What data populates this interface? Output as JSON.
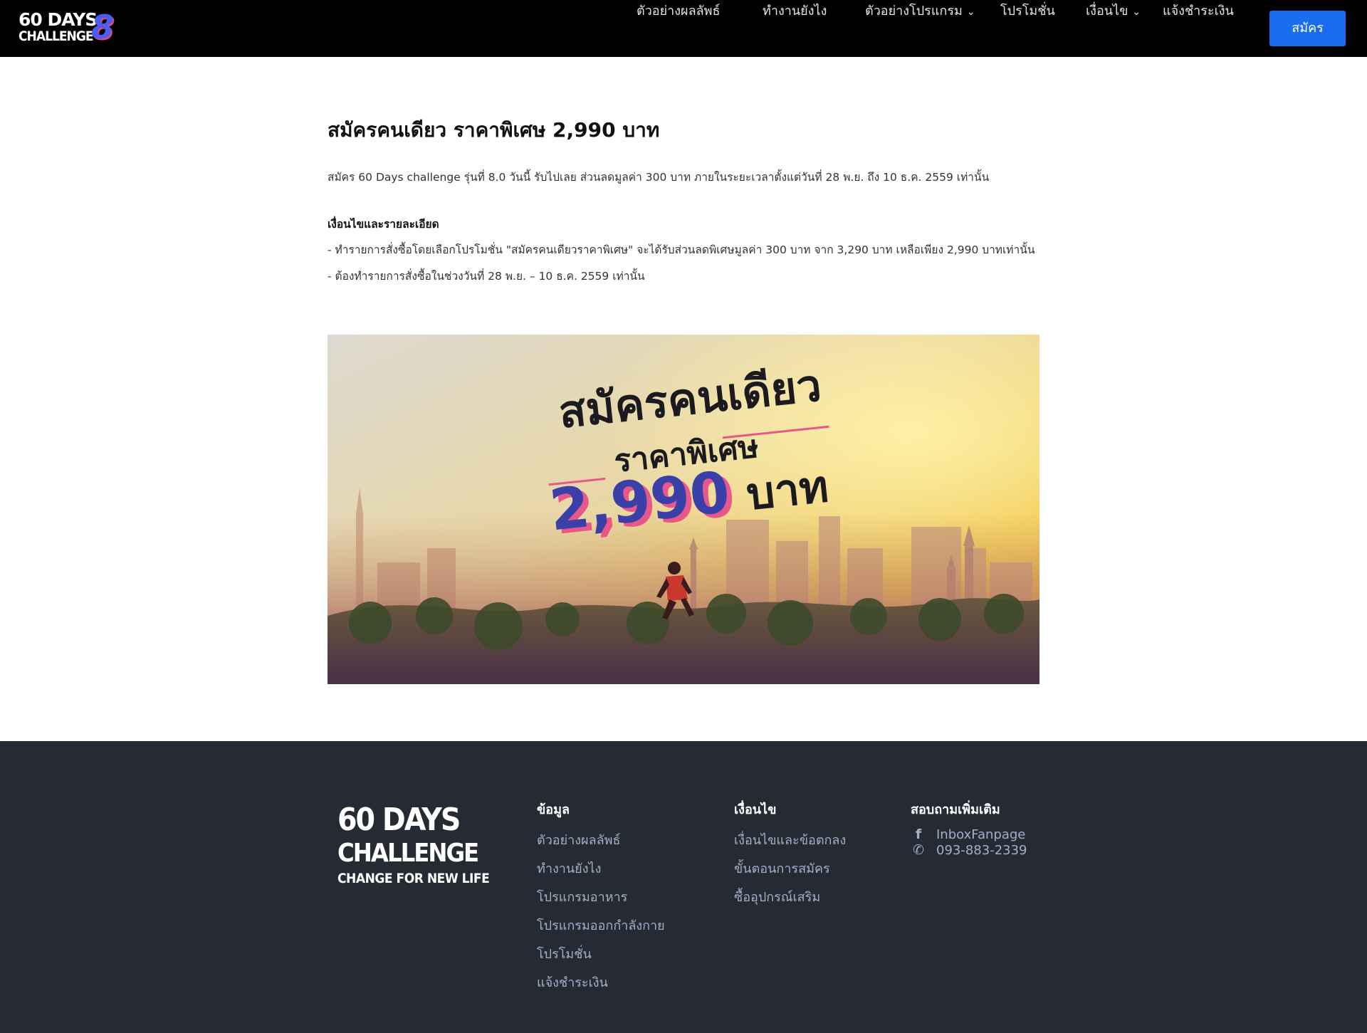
{
  "header": {
    "logo": {
      "line1": "60 DAYS",
      "line2": "CHALLENGE",
      "badge": "8"
    },
    "nav": [
      {
        "label": "ตัวอย่างผลลัพธ์",
        "dropdown": false
      },
      {
        "label": "ทำงานยังไง",
        "dropdown": false
      },
      {
        "label": "ตัวอย่างโปรแกรม",
        "dropdown": true
      },
      {
        "label": "โปรโมชั่น",
        "dropdown": false
      },
      {
        "label": "เงื่อนไข",
        "dropdown": true
      },
      {
        "label": "แจ้งชำระเงิน",
        "dropdown": false
      }
    ],
    "signup_label": "สมัคร"
  },
  "article": {
    "title": "สมัครคนเดียว ราคาพิเศษ 2,990 บาท",
    "intro": "สมัคร 60 Days challenge รุ่นที่ 8.0 วันนี้ รับไปเลย ส่วนลดมูลค่า 300 บาท ภายในระยะเวลาตั้งแต่วันที่ 28 พ.ย. ถึง 10 ธ.ค. 2559 เท่านั้น",
    "conditions_heading": "เงื่อนไขและรายละเอียด",
    "conditions": [
      "- ทำรายการสั่งซื้อโดยเลือกโปรโมชั่น \"สมัครคนเดียวราคาพิเศษ\" จะได้รับส่วนลดพิเศษมูลค่า 300 บาท จาก 3,290 บาท เหลือเพียง 2,990 บาทเท่านั้น",
      "- ต้องทำรายการสั่งซื้อในช่วงวันที่ 28 พ.ย. – 10 ธ.ค. 2559 เท่านั้น"
    ],
    "banner": {
      "line1": "สมัครคนเดียว",
      "line2": "ราคาพิเศษ",
      "price": "2,990",
      "unit": "บาท"
    }
  },
  "footer": {
    "logo": {
      "line1": "60 DAYS",
      "line2": "CHALLENGE",
      "line3": "CHANGE FOR NEW LIFE"
    },
    "col_info": {
      "heading": "ข้อมูล",
      "links": [
        "ตัวอย่างผลลัพธ์",
        "ทำงานยังไง",
        "โปรแกรมอาหาร",
        "โปรแกรมออกกำลังกาย",
        "โปรโมชั่น",
        "แจ้งชำระเงิน"
      ]
    },
    "col_terms": {
      "heading": "เงื่อนไข",
      "links": [
        "เงื่อนไขและข้อตกลง",
        "ขั้นตอนการสมัคร",
        "ซื้ออุปกรณ์เสริม"
      ]
    },
    "col_contact": {
      "heading": "สอบถามเพิ่มเติม",
      "facebook": "InboxFanpage",
      "phone": "093-883-2339"
    }
  },
  "colors": {
    "nav_bg": "#000000",
    "accent": "#1a6cf0",
    "footer_bg": "#262b33",
    "footer_link": "#9fb0c8"
  },
  "icons": {
    "facebook": "facebook-icon",
    "phone": "phone-icon",
    "chevron": "chevron-down-icon"
  }
}
